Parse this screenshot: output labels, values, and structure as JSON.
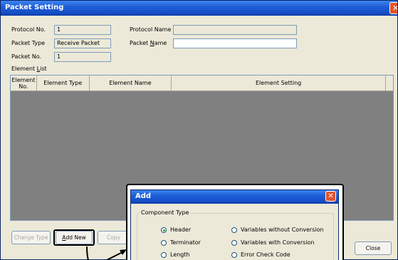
{
  "window": {
    "title": "Packet Setting",
    "close_glyph": "✕"
  },
  "fields": {
    "protocol_no_label": "Protocol No.",
    "protocol_no_value": "1",
    "packet_type_label": "Packet Type",
    "packet_type_value": "Receive Packet",
    "packet_no_label": "Packet No.",
    "packet_no_value": "1",
    "protocol_name_label": "Protocol Name",
    "protocol_name_value": "",
    "packet_name_label_pre": "Packet ",
    "packet_name_label_u": "N",
    "packet_name_label_post": "ame",
    "packet_name_value": ""
  },
  "element_list": {
    "label_pre": "Element ",
    "label_u": "L",
    "label_post": "ist",
    "columns": [
      "Element No.",
      "Element Type",
      "Element Name",
      "Element Setting"
    ]
  },
  "buttons": {
    "change_type": "Change Type",
    "add_new_u": "A",
    "add_new_rest": "dd New",
    "copy": "Copy",
    "close": "Close"
  },
  "add_dialog": {
    "title": "Add",
    "close_glyph": "✕",
    "group_label": "Component Type",
    "options": [
      {
        "label": "Header",
        "selected": true
      },
      {
        "label": "Terminator",
        "selected": false
      },
      {
        "label": "Length",
        "selected": false
      },
      {
        "label": "Variables without Conversion",
        "selected": false
      },
      {
        "label": "Variables with Conversion",
        "selected": false
      },
      {
        "label": "Error Check Code",
        "selected": false
      }
    ]
  },
  "colors": {
    "titlebar": "#1f5ed8",
    "list_bg": "#808080",
    "window_bg": "#ece9d8"
  }
}
